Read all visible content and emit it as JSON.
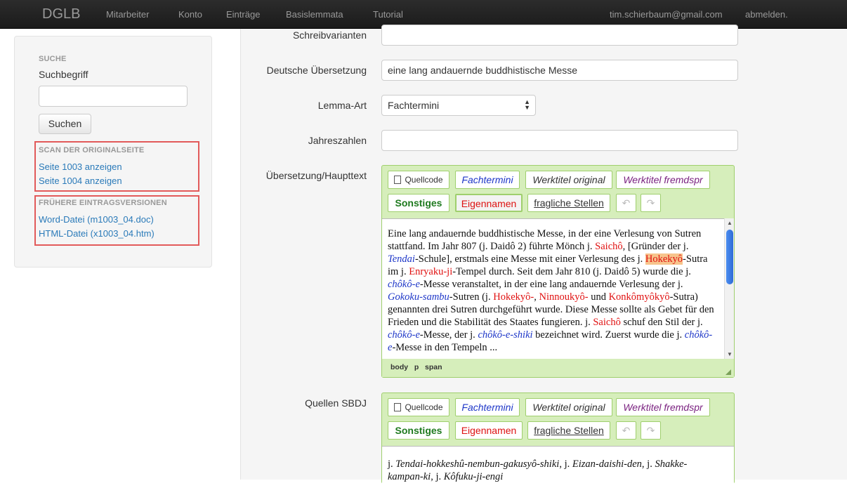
{
  "navbar": {
    "brand": "DGLB",
    "items": [
      "Mitarbeiter",
      "Konto",
      "Einträge",
      "Basislemmata",
      "Tutorial"
    ],
    "user": "tim.schierbaum@gmail.com",
    "logout": "abmelden."
  },
  "sidebar": {
    "search_heading": "SUCHE",
    "search_label": "Suchbegriff",
    "search_value": "",
    "search_button": "Suchen",
    "scan_heading": "SCAN DER ORIGINALSEITE",
    "scan_links": [
      "Seite 1003 anzeigen",
      "Seite 1004 anzeigen"
    ],
    "versions_heading": "FRÜHERE EINTRAGSVERSIONEN",
    "version_links": [
      "Word-Datei (m1003_04.doc)",
      "HTML-Datei (x1003_04.htm)"
    ]
  },
  "form": {
    "schreibvarianten_label": "Schreibvarianten",
    "schreibvarianten_value": "",
    "uebersetzung_label": "Deutsche Übersetzung",
    "uebersetzung_value": "eine lang andauernde buddhistische Messe",
    "lemma_art_label": "Lemma-Art",
    "lemma_art_value": "Fachtermini",
    "jahreszahlen_label": "Jahreszahlen",
    "jahreszahlen_value": "",
    "haupttext_label": "Übersetzung/Haupttext",
    "quellen_label": "Quellen SBDJ"
  },
  "toolbar": {
    "quellcode": "Quellcode",
    "fachtermini": "Fachtermini",
    "werktitel_original": "Werktitel original",
    "werktitel_fremdspr": "Werktitel fremdspr",
    "sonstiges": "Sonstiges",
    "eigennamen": "Eigennamen",
    "fragliche": "fragliche Stellen",
    "undo": "↶",
    "redo": "↷"
  },
  "haupttext": {
    "segments": [
      {
        "t": "Eine lang andauernde buddhistische Messe, in der eine Verlesung von Sutren stattfand. Im Jahr 807 (j. Daidô 2) führte Mönch j. ",
        "c": ""
      },
      {
        "t": "Saichô",
        "c": "r"
      },
      {
        "t": ", [Gründer der j. ",
        "c": ""
      },
      {
        "t": "Tendai",
        "c": "b"
      },
      {
        "t": "-Schule], erstmals eine Messe mit einer Verlesung des j. ",
        "c": ""
      },
      {
        "t": "Hokekyô",
        "c": "hl"
      },
      {
        "t": "-Sutra im j. ",
        "c": ""
      },
      {
        "t": "Enryaku-ji",
        "c": "r"
      },
      {
        "t": "-Tempel durch. Seit dem Jahr 810 (j. Daidô 5) wurde die j. ",
        "c": ""
      },
      {
        "t": "chôkô-e",
        "c": "b"
      },
      {
        "t": "-Messe veranstaltet, in der eine lang andauernde Verlesung der j. ",
        "c": ""
      },
      {
        "t": "Gokoku-sambu",
        "c": "b"
      },
      {
        "t": "-Sutren (j. ",
        "c": ""
      },
      {
        "t": "Hokekyô-",
        "c": "r"
      },
      {
        "t": ", ",
        "c": ""
      },
      {
        "t": "Ninnoukyô-",
        "c": "r"
      },
      {
        "t": " und ",
        "c": ""
      },
      {
        "t": "Konkômyôkyô",
        "c": "r"
      },
      {
        "t": "-Sutra) genannten drei Sutren durchgeführt wurde. Diese Messe sollte als Gebet für den Frieden und die Stabilität des Staates fungieren. j. ",
        "c": ""
      },
      {
        "t": "Saichô",
        "c": "r"
      },
      {
        "t": " schuf den Stil der j. ",
        "c": ""
      },
      {
        "t": "chôkô-e",
        "c": "b"
      },
      {
        "t": "-Messe, der j. ",
        "c": ""
      },
      {
        "t": "chôkô-e-shiki",
        "c": "b"
      },
      {
        "t": " bezeichnet wird. Zuerst wurde die j. ",
        "c": ""
      },
      {
        "t": "chôkô-e",
        "c": "b"
      },
      {
        "t": "-Messe in den Tempeln ...",
        "c": ""
      }
    ],
    "statusbar": [
      "body",
      "p",
      "span"
    ]
  },
  "quellen": {
    "segments": [
      {
        "t": "j. ",
        "c": ""
      },
      {
        "t": "Tendai-hokkeshû-nembun-gakusyô-shiki",
        "c": "i"
      },
      {
        "t": ", j. ",
        "c": ""
      },
      {
        "t": "Eizan-daishi-den",
        "c": "i"
      },
      {
        "t": ", j. ",
        "c": ""
      },
      {
        "t": "Shakke-kampan-ki",
        "c": "i"
      },
      {
        "t": ", j. ",
        "c": ""
      },
      {
        "t": "Kôfuku-ji-engi",
        "c": "i"
      }
    ]
  }
}
